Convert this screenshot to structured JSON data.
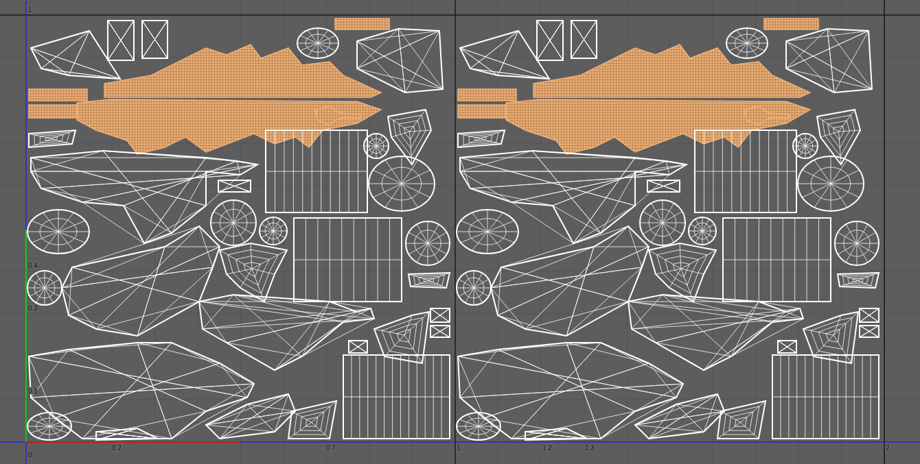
{
  "uv_editor": {
    "v_ticks": [
      "1",
      "0.4",
      "0.3",
      "0.1",
      "0"
    ],
    "u_ticks": [
      "0.2",
      "0.7",
      "1",
      "1.2",
      "1.3",
      "2"
    ]
  }
}
